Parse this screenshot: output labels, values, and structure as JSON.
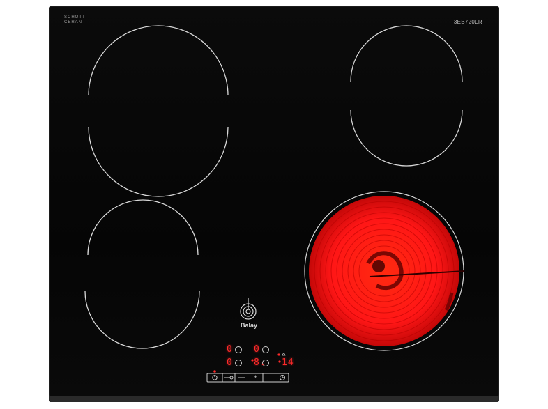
{
  "panel": {
    "material_brand_line1": "SCHOTT",
    "material_brand_line2": "CERAN",
    "model": "3EB720LR",
    "brand": "Balay"
  },
  "displays": {
    "zone_front_left": "0",
    "zone_rear_left": "0",
    "zone_rear_right": "0",
    "zone_front_right": "8.",
    "timer": "14"
  },
  "colors": {
    "glass": "#060606",
    "zone_outline": "#d9d9d9",
    "hot_zone": "#ff1a1a",
    "display_red": "#ff2a2a"
  },
  "controls": {
    "power_icon": "power-icon",
    "lock_icon": "key-lock-icon",
    "minus_label": "—",
    "plus_label": "+",
    "timer_icon": "clock-icon"
  }
}
